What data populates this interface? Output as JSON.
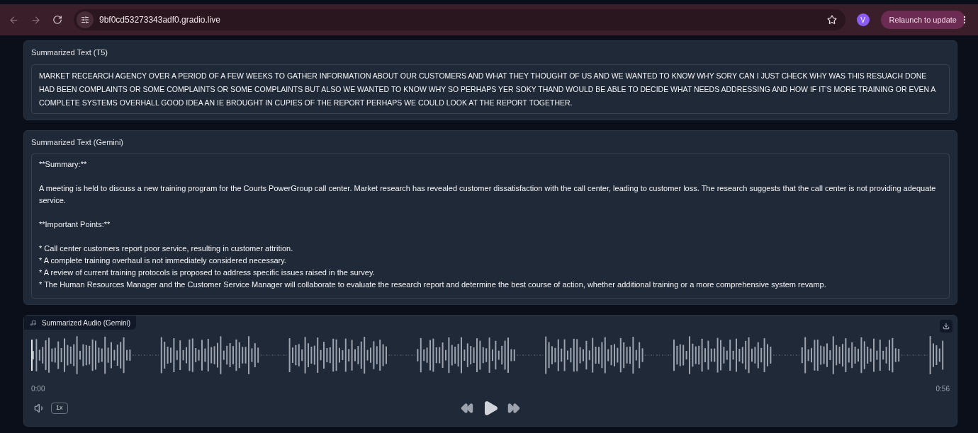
{
  "browser": {
    "url": "9bf0cd53273343adf0.gradio.live",
    "profile_initial": "V",
    "update_button": "Relaunch to update"
  },
  "t5": {
    "label": "Summarized Text (T5)",
    "value": "MARKET RECEARCH AGENCY OVER A PERIOD OF A FEW WEEKS TO GATHER INFORMATION ABOUT OUR CUSTOMERS AND WHAT THEY THOUGHT OF US AND WE WANTED TO KNOW WHY SORY CAN I JUST CHECK WHY WAS THIS RESUACH DONE HAD BEEN COMPLAINTS OR SOME COMPLAINTS OR SOME COMPLAINTS BUT ALSO WE WANTED TO KNOW WHY SO PERHAPS YER SOKY THAND WOULD BE ABLE TO DECIDE WHAT NEEDS ADDRESSING AND HOW IF IT'S MORE TRAINING OR EVEN A COMPLETE SYSTEMS OVERHALL GOOD IDEA AN IE BROUGHT IN CUPIES OF THE REPORT PERHAPS WE COULD LOOK AT THE REPORT TOGETHER."
  },
  "gemini": {
    "label": "Summarized Text (Gemini)",
    "paragraphs": [
      [
        "**Summary:**"
      ],
      [
        "A meeting is held to discuss a new training program for the Courts PowerGroup call center. Market research has revealed customer dissatisfaction with the call center, leading to customer loss. The research suggests that the call center is not providing adequate service."
      ],
      [
        "**Important Points:**"
      ],
      [
        "* Call center customers report poor service, resulting in customer attrition.",
        "* A complete training overhaul is not immediately considered necessary.",
        "* A review of current training protocols is proposed to address specific issues raised in the survey.",
        "* The Human Resources Manager and the Customer Service Manager will collaborate to evaluate the research report and determine the best course of action, whether additional training or a more comprehensive system revamp."
      ]
    ]
  },
  "audio": {
    "label": "Summarized Audio (Gemini)",
    "current_time": "0:00",
    "duration": "0:56",
    "speed": "1x"
  }
}
